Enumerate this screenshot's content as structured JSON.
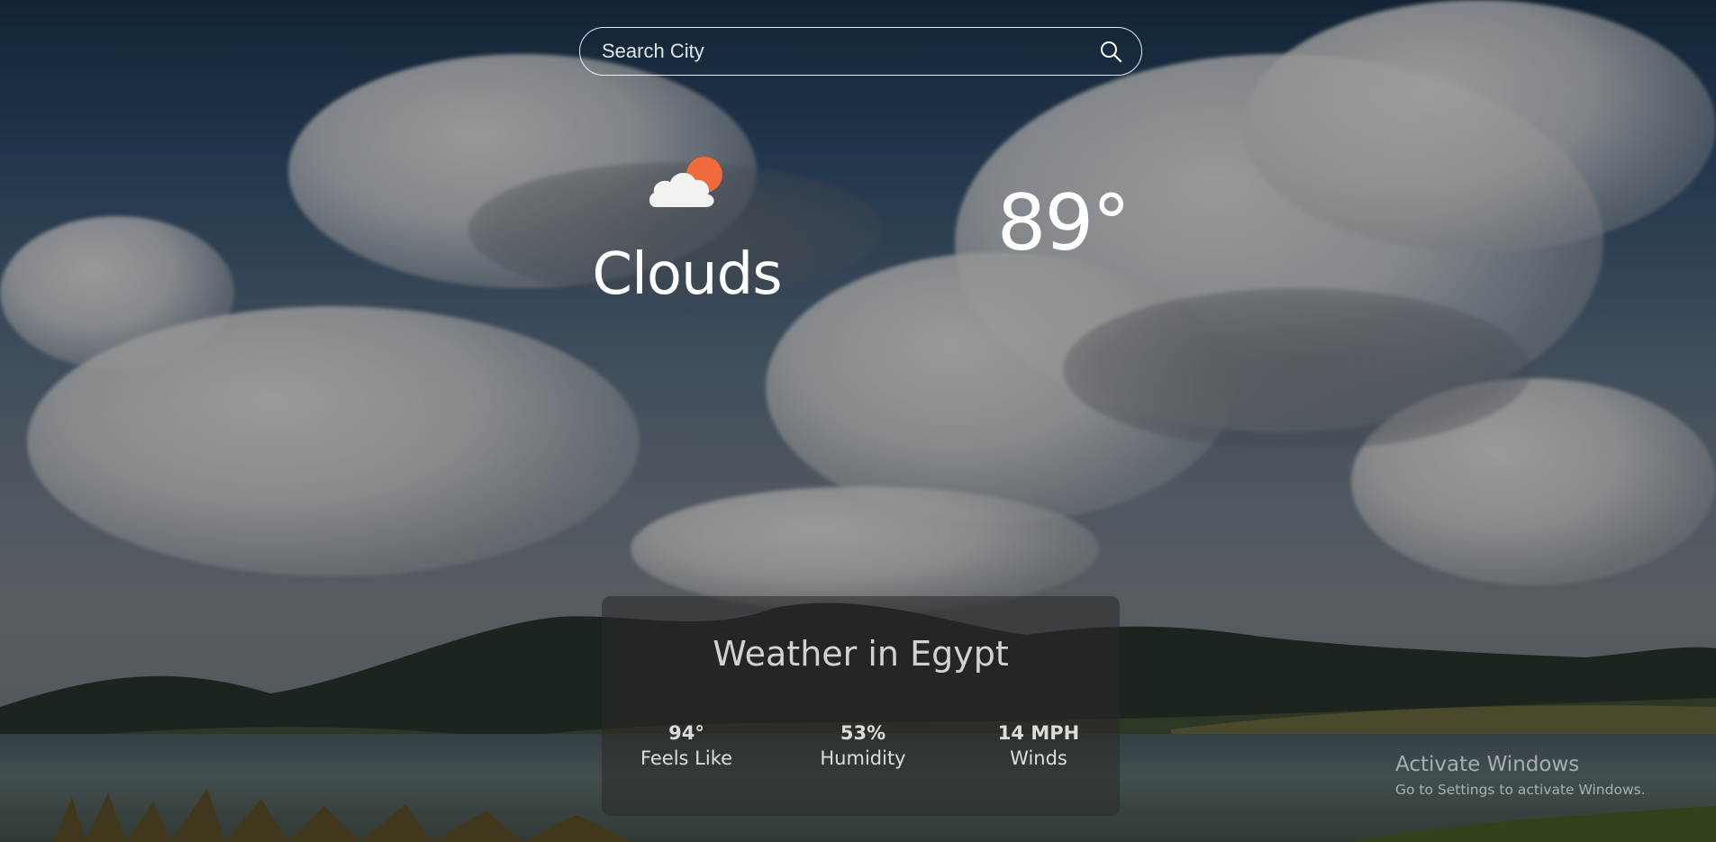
{
  "search": {
    "placeholder": "Search City",
    "icon": "search-icon"
  },
  "weather": {
    "icon": "partly-cloudy-icon",
    "condition": "Clouds",
    "temperature": "89°"
  },
  "card": {
    "title": "Weather in Egypt",
    "stats": [
      {
        "value": "94°",
        "label": "Feels Like"
      },
      {
        "value": "53%",
        "label": "Humidity"
      },
      {
        "value": "14 MPH",
        "label": "Winds"
      }
    ]
  },
  "watermark": {
    "line1": "Activate Windows",
    "line2": "Go to Settings to activate Windows."
  },
  "colors": {
    "sun": "#f06a3c",
    "cloud": "#ffffff",
    "card_bg": "rgba(40,40,40,0.55)"
  }
}
